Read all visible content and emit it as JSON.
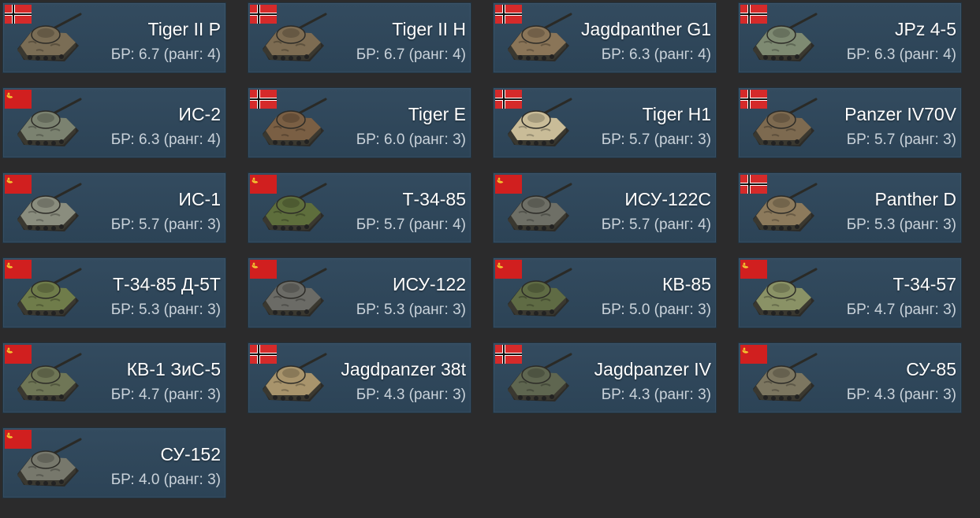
{
  "vehicles": [
    {
      "name": "Tiger II P",
      "br_text": "БР: 6.7 (ранг: 4)",
      "nation": "germany",
      "camo": "#7a6d55"
    },
    {
      "name": "Tiger II H",
      "br_text": "БР: 6.7 (ранг: 4)",
      "nation": "germany",
      "camo": "#7d6c52"
    },
    {
      "name": "Jagdpanther G1",
      "br_text": "БР: 6.3 (ранг: 4)",
      "nation": "germany",
      "camo": "#8a7558"
    },
    {
      "name": "JPz 4-5",
      "br_text": "БР: 6.3 (ранг: 4)",
      "nation": "germany",
      "camo": "#7e8a72"
    },
    {
      "name": "ИС-2",
      "br_text": "БР: 6.3 (ранг: 4)",
      "nation": "ussr",
      "camo": "#7b8270"
    },
    {
      "name": "Tiger E",
      "br_text": "БР: 6.0 (ранг: 3)",
      "nation": "germany",
      "camo": "#7a5f44"
    },
    {
      "name": "Tiger H1",
      "br_text": "БР: 5.7 (ранг: 3)",
      "nation": "germany",
      "camo": "#c9bc98"
    },
    {
      "name": "Panzer IV70V",
      "br_text": "БР: 5.7 (ранг: 3)",
      "nation": "germany",
      "camo": "#7d6a50"
    },
    {
      "name": "ИС-1",
      "br_text": "БР: 5.7 (ранг: 3)",
      "nation": "ussr",
      "camo": "#8a8d7e"
    },
    {
      "name": "Т-34-85",
      "br_text": "БР: 5.7 (ранг: 4)",
      "nation": "ussr",
      "camo": "#5e6e3c"
    },
    {
      "name": "ИСУ-122С",
      "br_text": "БР: 5.7 (ранг: 4)",
      "nation": "ussr",
      "camo": "#6e6f66"
    },
    {
      "name": "Panther D",
      "br_text": "БР: 5.3 (ранг: 3)",
      "nation": "germany",
      "camo": "#8c7a5c"
    },
    {
      "name": "Т-34-85 Д-5Т",
      "br_text": "БР: 5.3 (ранг: 3)",
      "nation": "ussr",
      "camo": "#6f7c4a"
    },
    {
      "name": "ИСУ-122",
      "br_text": "БР: 5.3 (ранг: 3)",
      "nation": "ussr",
      "camo": "#6b6b66"
    },
    {
      "name": "КВ-85",
      "br_text": "БР: 5.0 (ранг: 3)",
      "nation": "ussr",
      "camo": "#5f6b44"
    },
    {
      "name": "Т-34-57",
      "br_text": "БР: 4.7 (ранг: 3)",
      "nation": "ussr",
      "camo": "#8a9266"
    },
    {
      "name": "КВ-1 ЗиС-5",
      "br_text": "БР: 4.7 (ранг: 3)",
      "nation": "ussr",
      "camo": "#6f7656"
    },
    {
      "name": "Jagdpanzer 38t",
      "br_text": "БР: 4.3 (ранг: 3)",
      "nation": "germany",
      "camo": "#a8946c"
    },
    {
      "name": "Jagdpanzer IV",
      "br_text": "БР: 4.3 (ранг: 3)",
      "nation": "germany",
      "camo": "#5f6650"
    },
    {
      "name": "СУ-85",
      "br_text": "БР: 4.3 (ранг: 3)",
      "nation": "ussr",
      "camo": "#7c7660"
    },
    {
      "name": "СУ-152",
      "br_text": "БР: 4.0 (ранг: 3)",
      "nation": "ussr",
      "camo": "#77786c"
    }
  ],
  "colors": {
    "background": "#2b2b2c",
    "card": "#304759",
    "name_text": "#ffffff",
    "br_text": "#c9d2da",
    "ussr_red": "#d11f1f",
    "germany_red": "#d52a2a"
  }
}
